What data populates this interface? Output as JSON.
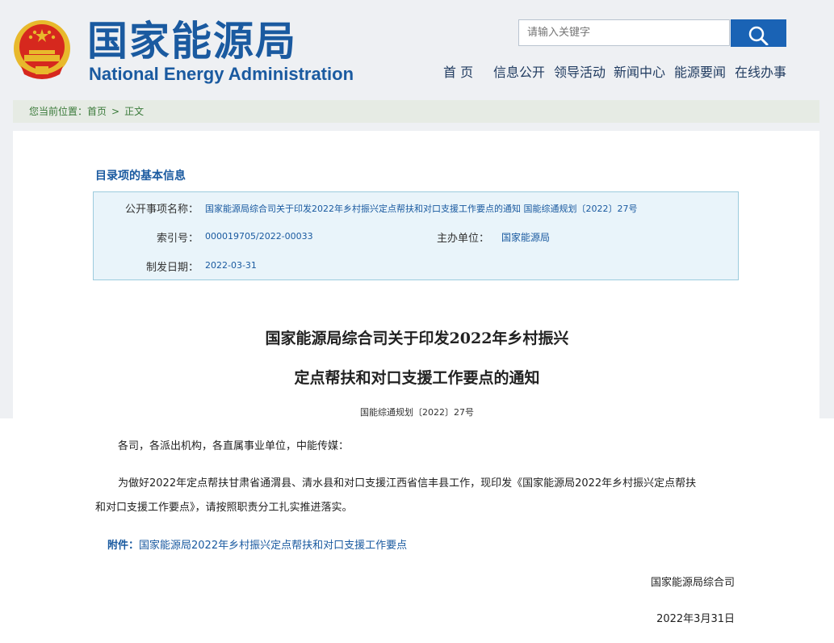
{
  "header": {
    "title_cn": "国家能源局",
    "title_en": "National Energy Administration",
    "search_placeholder": "请输入关键字"
  },
  "nav": [
    "首 页",
    "信息公开",
    "领导活动",
    "新闻中心",
    "能源要闻",
    "在线办事"
  ],
  "breadcrumb": {
    "prefix": "您当前位置：",
    "home": "首页",
    "separator": ">",
    "current": "正文"
  },
  "info": {
    "section_title": "目录项的基本信息",
    "label_name": "公开事项名称：",
    "value_name": "国家能源局综合司关于印发2022年乡村振兴定点帮扶和对口支援工作要点的通知 国能综通规划〔2022〕27号",
    "label_index": "索引号：",
    "value_index": "000019705/2022-00033",
    "label_unit": "主办单位：",
    "value_unit": "国家能源局",
    "label_date": "制发日期：",
    "value_date": "2022-03-31"
  },
  "document": {
    "title_line1": "国家能源局综合司关于印发2022年乡村振兴",
    "title_line2": "定点帮扶和对口支援工作要点的通知",
    "doc_no": "国能综通规划〔2022〕27号",
    "greeting": "各司，各派出机构，各直属事业单位，中能传媒：",
    "body_line1": "为做好2022年定点帮扶甘肃省通渭县、清水县和对口支援江西省信丰县工作，现印发《国家能源局2022年乡村振兴定点帮扶",
    "body_line2": "和对口支援工作要点》，请按照职责分工扎实推进落实。",
    "attach_label": "附件：",
    "attach_link": "国家能源局2022年乡村振兴定点帮扶和对口支援工作要点",
    "sign_org": "国家能源局综合司",
    "sign_date": "2022年3月31日"
  },
  "colors": {
    "brand_blue": "#1a5aa0",
    "search_blue": "#1a63b5",
    "emblem_red": "#d6281e",
    "emblem_gold": "#e8b92c"
  }
}
